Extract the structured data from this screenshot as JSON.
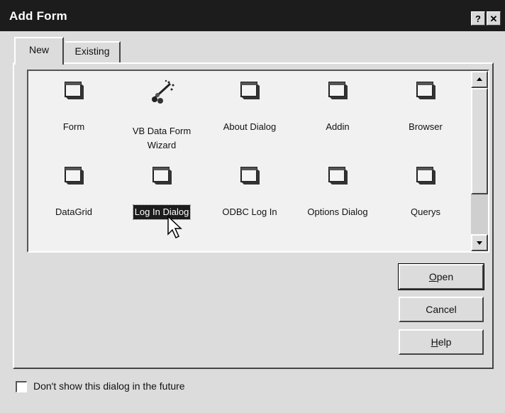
{
  "window": {
    "title": "Add Form",
    "help_label": "?",
    "close_label": "✕"
  },
  "tabs": [
    {
      "label": "New",
      "selected": true
    },
    {
      "label": "Existing",
      "selected": false
    }
  ],
  "items": [
    {
      "label": "Form",
      "icon": "form-icon"
    },
    {
      "label": "VB Data Form Wizard",
      "icon": "wizard-icon"
    },
    {
      "label": "About Dialog",
      "icon": "form-icon"
    },
    {
      "label": "Addin",
      "icon": "form-icon"
    },
    {
      "label": "Browser",
      "icon": "form-icon"
    },
    {
      "label": "DataGrid",
      "icon": "form-icon"
    },
    {
      "label": "Log In Dialog",
      "icon": "form-icon",
      "selected": true
    },
    {
      "label": "ODBC Log In",
      "icon": "form-icon"
    },
    {
      "label": "Options Dialog",
      "icon": "form-icon"
    },
    {
      "label": "Querys",
      "icon": "form-icon"
    }
  ],
  "buttons": {
    "open": "Open",
    "open_mnemonic": "O",
    "cancel": "Cancel",
    "help": "Help",
    "help_mnemonic": "H"
  },
  "footer": {
    "checkbox_label": "Don't show this dialog in the future",
    "checked": false
  },
  "colors": {
    "titlebar": "#1c1c1c",
    "face": "#dcdcdc",
    "selection": "#1c1c1c"
  }
}
